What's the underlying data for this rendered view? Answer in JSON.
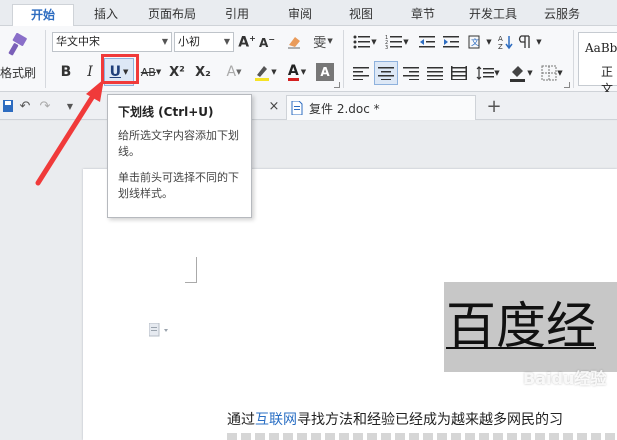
{
  "menu": {
    "tabs": [
      {
        "label": "开始",
        "active": true
      },
      {
        "label": "插入"
      },
      {
        "label": "页面布局"
      },
      {
        "label": "引用"
      },
      {
        "label": "审阅"
      },
      {
        "label": "视图"
      },
      {
        "label": "章节"
      },
      {
        "label": "开发工具"
      },
      {
        "label": "云服务"
      }
    ]
  },
  "ribbon": {
    "format_painter_label": "格式刷",
    "font_name": "华文中宋",
    "font_size": "小初",
    "bold": "B",
    "italic": "I",
    "underline": "U",
    "strikethrough": "AB",
    "superscript": "X²",
    "subscript": "X₂",
    "pinyin": "雯",
    "style_preview": "AaBb",
    "style_name": "正文"
  },
  "tabs": {
    "document_tab": "复件 2.doc *"
  },
  "tooltip": {
    "title": "下划线 (Ctrl+U)",
    "line1": "给所选文字内容添加下划线。",
    "line2": "单击前头可选择不同的下划线样式。"
  },
  "document": {
    "heading": "百度经",
    "body_prefix": "通过",
    "body_link": "互联网",
    "body_suffix": "寻找方法和经验已经成为越来越多网民的习"
  },
  "watermark": "Baidu经验",
  "colors": {
    "accent": "#2d6cc0",
    "highlight": "#f03a3a",
    "heading_bg": "#c7c7c7",
    "link": "#2a6fc4"
  }
}
